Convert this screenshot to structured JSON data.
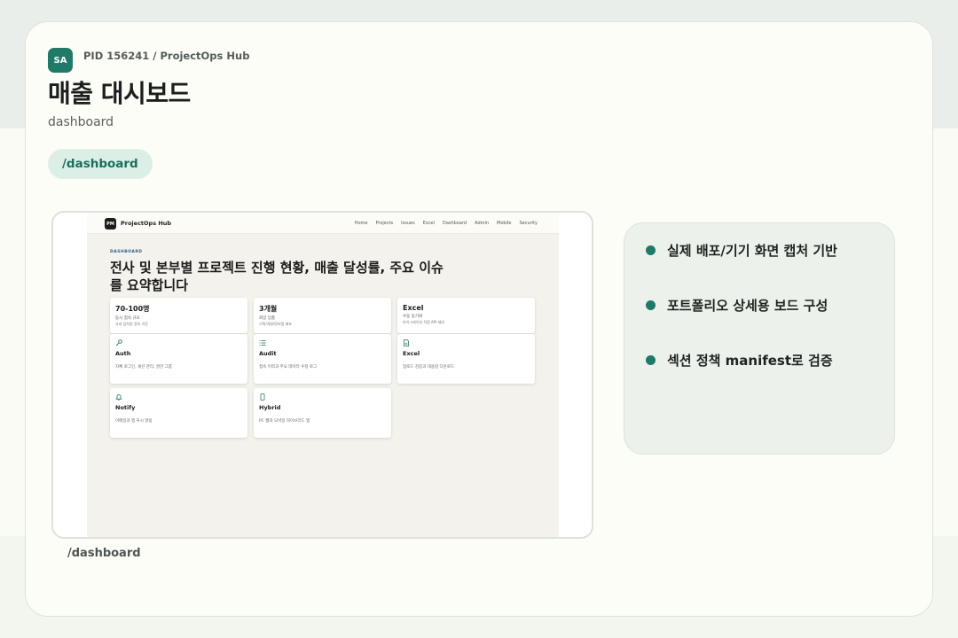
{
  "header": {
    "avatar": "SA",
    "pid": "PID 156241 / ProjectOps Hub",
    "title": "매출 대시보드",
    "subtitle": "dashboard",
    "route": "/dashboard"
  },
  "preview": {
    "brand_logo": "PM",
    "brand": "ProjectOps Hub",
    "nav": [
      "Home",
      "Projects",
      "Issues",
      "Excel",
      "Dashboard",
      "Admin",
      "Mobile",
      "Security"
    ],
    "kicker": "DASHBOARD",
    "headline": "전사 및 본부별 프로젝트 진행 현황, 매출 달성률, 주요 이슈를 요약합니다",
    "stats": [
      {
        "value": "70-100명",
        "label": "동시 접속 규모",
        "note": "사내 임직원 접속 기준"
      },
      {
        "value": "3개월",
        "label": "회망 납품",
        "note": "기획/개발/QA/앱 배포"
      },
      {
        "value": "Excel",
        "label": "수동 동기화",
        "note": "마이그레이션 직접 API 제외"
      }
    ],
    "modules": [
      {
        "icon": "key-icon",
        "name": "Auth",
        "desc": "자체 로그인, 세션 관리, 권한 그룹"
      },
      {
        "icon": "list-icon",
        "name": "Audit",
        "desc": "접속 이력과 주요 데이터 수정 로그"
      },
      {
        "icon": "file-icon",
        "name": "Excel",
        "desc": "업로드 검증과 대용량 다운로드"
      },
      {
        "icon": "bell-icon",
        "name": "Notify",
        "desc": "이메일과 앱 푸시 알림"
      },
      {
        "icon": "mobile-icon",
        "name": "Hybrid",
        "desc": "PC 웹과 모바일 하이브리드 앱"
      }
    ]
  },
  "caption": "/dashboard",
  "bullets": [
    "실제 배포/기기 화면 캡처 기반",
    "포트폴리오 상세용 보드 구성",
    "섹션 정책 manifest로 검증"
  ],
  "colors": {
    "accent": "#1f7a67",
    "pill_bg": "#dcefe6",
    "side_bg": "#edf1ec"
  }
}
